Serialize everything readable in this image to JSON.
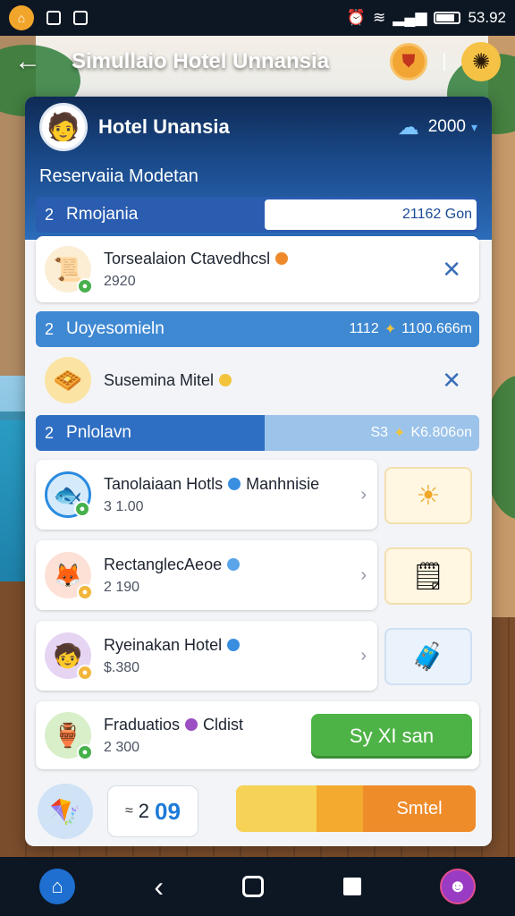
{
  "status_bar": {
    "time": "53.92",
    "icons": [
      "app-icon",
      "notification-icon",
      "gallery-icon",
      "alarm-icon",
      "wifi-icon",
      "signal-icon",
      "battery-icon"
    ]
  },
  "app_bar": {
    "title": "Simullaio Hotel Unnansia",
    "back_icon": "←",
    "shield_icon": "⛊",
    "gear_icon": "✺"
  },
  "header": {
    "avatar": "🧑",
    "hotel_name": "Hotel Unansia",
    "coin_icon": "☁",
    "coin_value": "2000",
    "chevron": "▾",
    "subtitle": "Reservaiia Modetan"
  },
  "section1": {
    "num": "2",
    "label": "Rmojania",
    "value": "21162 Gon",
    "card": {
      "icon": "📜",
      "title": "Torsealaion Ctavedhcsl",
      "sub": "2920",
      "dot_color": "#f0892b",
      "close": "✕"
    }
  },
  "section2": {
    "num": "2",
    "label": "Uoyesomieln",
    "value": "1100.666m",
    "value_prefix": "1112",
    "card": {
      "icon": "🧇",
      "title": "Susemina Mitel",
      "dot_color": "#f2c43c",
      "close": "✕"
    }
  },
  "section3": {
    "num": "2",
    "label": "Pnlolavn",
    "value": "K6.806on",
    "value_prefix": "S3"
  },
  "list": [
    {
      "icon": "🐟",
      "title": "Tanolaiaan Hotls",
      "title_suffix": "Manhnisie",
      "sub": "3 1.00",
      "dot_color": "#3a8ee0",
      "chevron": "›",
      "side_icon": "☀"
    },
    {
      "icon": "🦊",
      "title": "RectanglecAeoe",
      "title_suffix": "",
      "sub": "2 190",
      "dot_color": "#5aa5e8",
      "chevron": "›",
      "side_icon": "🗒"
    },
    {
      "icon": "🧒",
      "title": "Ryeinakan Hotel",
      "title_suffix": "",
      "sub": "$.380",
      "dot_color": "#3a8ee0",
      "chevron": "›",
      "side_icon": "🧳"
    }
  ],
  "featured": {
    "icon": "🏺",
    "title": "Fraduatios",
    "title_suffix": "Cldist",
    "sub": "2 300",
    "dot_color": "#9b4fc2",
    "button": "Sy XI san"
  },
  "footer": {
    "icon": "🪁",
    "counter_prefix": "≈",
    "counter_value": "2",
    "counter_accent": "09",
    "button_label": "Smtel",
    "progress": 0.53
  },
  "nav": {
    "home": "⌂",
    "back": "‹",
    "profile": "☻"
  }
}
